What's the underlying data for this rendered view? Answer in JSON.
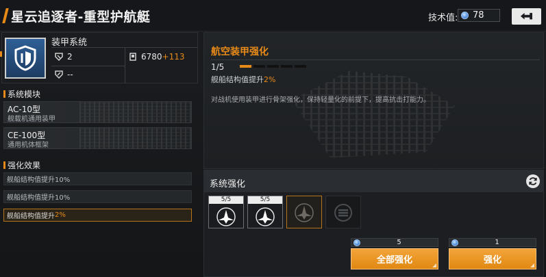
{
  "header": {
    "title": "星云追逐者-重型护航艇",
    "tech_label": "技术值:",
    "tech_value": "78"
  },
  "armor": {
    "title": "装甲系统",
    "level": "2",
    "power": "6780",
    "power_bonus": "+113",
    "extra": "--"
  },
  "modules": {
    "title": "系统模块",
    "items": [
      {
        "name": "AC-10型",
        "desc": "舰载机通用装甲"
      },
      {
        "name": "CE-100型",
        "desc": "通用机体框架"
      }
    ]
  },
  "effects": {
    "title": "强化效果",
    "items": [
      {
        "text": "舰船结构值提升10%",
        "hl": ""
      },
      {
        "text": "舰船结构值提升10%",
        "hl": ""
      },
      {
        "text": "舰船结构值提升",
        "hl": "2%"
      }
    ]
  },
  "enhance": {
    "title": "航空装甲强化",
    "progress_label": "1/5",
    "progress": {
      "current": 1,
      "total": 5
    },
    "line_prefix": "舰船结构值提升",
    "line_value": "2%",
    "description": "对战机使用装甲进行骨架强化，保持轻量化的前提下，提高抗击打能力。"
  },
  "system": {
    "title": "系统强化",
    "slots": [
      {
        "count": "5/5",
        "state": "done"
      },
      {
        "count": "5/5",
        "state": "done"
      },
      {
        "count": "",
        "state": "selected"
      },
      {
        "count": "",
        "state": "locked"
      }
    ]
  },
  "actions": {
    "all": {
      "label": "全部强化",
      "cost": "5"
    },
    "one": {
      "label": "强化",
      "cost": "1"
    }
  },
  "colors": {
    "accent": "#e88a17",
    "background": "#141618"
  }
}
